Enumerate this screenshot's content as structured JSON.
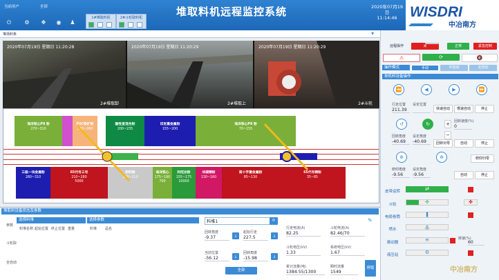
{
  "header": {
    "title": "堆取料机远程监控系统",
    "date": "2020年07月19日",
    "time": "11:14:46",
    "left_labels": [
      "当前用户",
      "全部"
    ],
    "machines": [
      {
        "label": "1#堆取料机"
      },
      {
        "label": "2#斗轮取料机"
      }
    ]
  },
  "toolbar": {
    "label": "堆场料条"
  },
  "cameras": [
    {
      "timestamp": "2020年07月19日 星期日 11:20:28",
      "name": "2#堆取卸"
    },
    {
      "timestamp": "2020年07月19日 星期日 11:20:29",
      "name": "2#堆取上"
    },
    {
      "timestamp": "2020年07月19日 星期日 11:20:29",
      "name": "2#斗轮"
    }
  ],
  "piles_top": [
    {
      "name": "海洋铁心P8 粉",
      "range": "270~310",
      "color": "#7ab03a"
    },
    {
      "name": "",
      "range": "",
      "color": "#d050d0"
    },
    {
      "name": "PSC铁矿粉",
      "range": "240~260",
      "color": "#f6b47a"
    },
    {
      "name": "酸性复混合粉",
      "range": "200~235",
      "color": "#0f8a44"
    },
    {
      "name": "印尼重金属粉",
      "range": "155~200",
      "color": "#1d1db0"
    },
    {
      "name": "海洋铁心P8 粉",
      "range": "70~155",
      "color": "#7ab03a"
    }
  ],
  "piles_bottom": [
    {
      "name": "三级一块金属粉",
      "range": "280~310",
      "color": "#1d1db0"
    },
    {
      "name": "65代号三号",
      "range": "210~280",
      "color": "#c0141e"
    },
    {
      "name": "卸料粉",
      "range": "180~210",
      "color": "#c9c9c9"
    },
    {
      "name": "海洋铁心",
      "range": "175~190",
      "color": "#7ab03a"
    },
    {
      "name": "利旺达粉",
      "range": "155~175",
      "color": "#2a9a3a"
    },
    {
      "name": "块碳精粉",
      "range": "130~160",
      "color": "#d01864"
    },
    {
      "name": "南十字重金属粉",
      "range": "85~130",
      "color": "#c0141e"
    },
    {
      "name": "65代号精粉",
      "range": "35~85",
      "color": "#c0141e"
    }
  ],
  "pile_sub": {
    "b1": "5000",
    "b3": "700",
    "b4": "10000"
  },
  "bottom": {
    "section_title": "堆取料设备状态及参数",
    "side_tabs": [
      "参数",
      "斗轮取",
      "全自动"
    ],
    "table1_title": "选择料堆",
    "table1_headers": [
      "料堆名称",
      "起始位置",
      "终止位置",
      "重量"
    ],
    "table2_title": "选择参数",
    "table2_headers": [
      "料堆",
      "品名"
    ],
    "pile_select": "料堆1",
    "fields": [
      {
        "label": "回转角度",
        "value": "-9.37"
      },
      {
        "label": "起始行走",
        "value": "227.5"
      },
      {
        "label": "当前位置",
        "value": "-56.12"
      },
      {
        "label": "回转角度",
        "value": "-15.98"
      }
    ],
    "all_btn": "全部",
    "readouts": [
      {
        "label": "行走电流(A)",
        "value": "82.25"
      },
      {
        "label": "斗轮电流(A)",
        "value": "82.46/70"
      },
      {
        "label": "斗轮电压(kV)",
        "value": "1.33"
      },
      {
        "label": "系统电压(kV)",
        "value": "1.67"
      },
      {
        "label": "累计流量(吨)",
        "value": "1384.55/1300"
      },
      {
        "label": "瞬时流量",
        "value": "1549"
      }
    ],
    "stop_btn": "停取"
  },
  "right": {
    "top_btns": [
      "远程操作",
      "近程操作",
      "正常",
      "紧急控制"
    ],
    "icons_row2": [
      "reset-icon",
      "refresh-icon",
      "mute-icon"
    ],
    "mode_label": "操作模式",
    "mode_tabs": [
      "手动",
      "半自动",
      "全自动"
    ],
    "section_ops": "单机料设备操作",
    "move": {
      "walk_pos_label": "行走位置",
      "walk_pos": "211.39",
      "set_label": "设定位置",
      "set_value": "",
      "btn_fast": "快速自动",
      "btn_slow": "慢速自动",
      "btn_stop": "停止"
    },
    "rotate": {
      "angle_label": "回转角度",
      "angle": "-40.69",
      "set_label": "设定角度",
      "set_value": "-40.69",
      "speed_label": "回转速度(%)",
      "speed": "0",
      "btn": "回转对零",
      "btn2": "自动",
      "btn_stop": "停止"
    },
    "pitch": {
      "angle_label": "俯仰角度",
      "angle": "-9.56",
      "set_label": "设定角度",
      "set_value": "-9.56",
      "btn": "自动",
      "btn_stop": "停止",
      "btn_ret": "俯仰归零"
    },
    "devices": [
      {
        "name": "皮带运转"
      },
      {
        "name": "斗轮"
      },
      {
        "name": "电缆卷筒"
      },
      {
        "name": "喷水"
      },
      {
        "name": "振动器"
      },
      {
        "name": "液压站"
      }
    ],
    "speed_label": "转速(%)",
    "speed_value": "60",
    "watermark": "中冶南方"
  },
  "logo": {
    "text": "WISDRI",
    "sub": "中冶南方"
  }
}
